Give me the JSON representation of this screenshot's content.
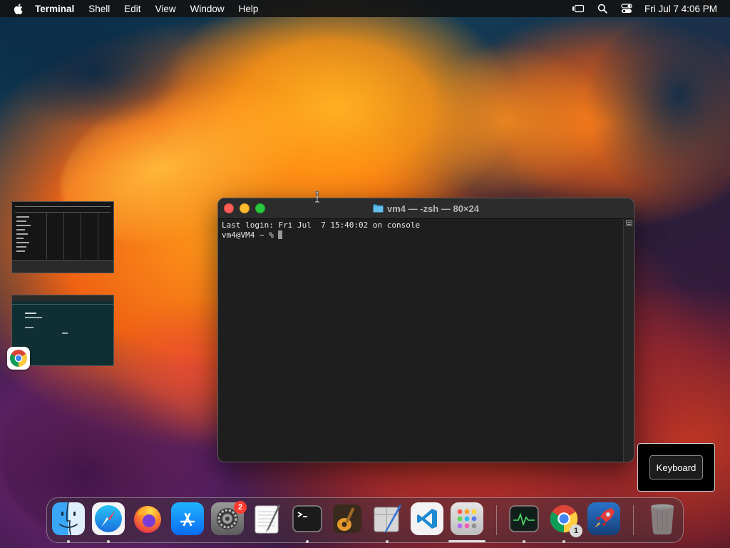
{
  "menubar": {
    "app_name": "Terminal",
    "items": [
      "Shell",
      "Edit",
      "View",
      "Window",
      "Help"
    ],
    "clock": "Fri Jul 7  4:06 PM",
    "icons": [
      "apple-icon",
      "stage-manager-icon",
      "spotlight-search-icon",
      "control-center-icon"
    ]
  },
  "terminal": {
    "title": "vm4 — -zsh — 80×24",
    "lines": [
      "Last login: Fri Jul  7 15:40:02 on console",
      "vm4@VM4 ~ % "
    ]
  },
  "keyboard_popup": {
    "label": "Keyboard"
  },
  "dock": {
    "apps": [
      {
        "name": "Finder",
        "running": true
      },
      {
        "name": "Safari",
        "running": true
      },
      {
        "name": "Firefox",
        "running": false
      },
      {
        "name": "App Store",
        "running": false
      },
      {
        "name": "System Settings",
        "running": false,
        "badge": "2"
      },
      {
        "name": "TextEdit",
        "running": false
      },
      {
        "name": "Terminal",
        "running": true
      },
      {
        "name": "GarageBand",
        "running": false
      },
      {
        "name": "Script Editor",
        "running": true
      },
      {
        "name": "Visual Studio Code",
        "running": false
      },
      {
        "name": "Launchpad",
        "running": false
      },
      {
        "name": "Activity Monitor",
        "running": true
      },
      {
        "name": "Google Chrome",
        "running": true,
        "badge": "1"
      },
      {
        "name": "RocketSim",
        "running": false
      },
      {
        "name": "Trash",
        "running": false
      }
    ]
  },
  "colors": {
    "menubar_bg": "#141414",
    "terminal_bg": "#1e1e1e",
    "close": "#ff5f57",
    "minimize": "#febc2e",
    "maximize": "#28c840",
    "badge": "#ff3b30"
  }
}
